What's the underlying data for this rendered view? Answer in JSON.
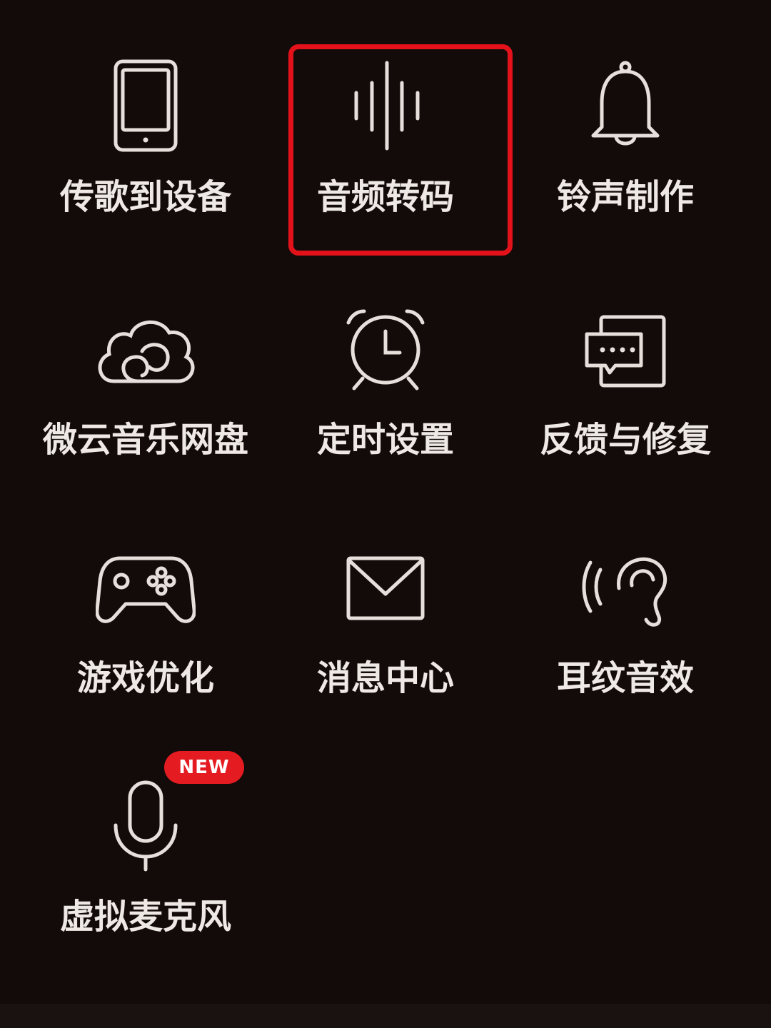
{
  "menu": {
    "items": [
      {
        "label": "传歌到设备",
        "icon": "device-transfer-icon"
      },
      {
        "label": "音频转码",
        "icon": "audio-wave-icon",
        "highlighted": true
      },
      {
        "label": "铃声制作",
        "icon": "bell-icon"
      },
      {
        "label": "微云音乐网盘",
        "icon": "cloud-icon"
      },
      {
        "label": "定时设置",
        "icon": "alarm-clock-icon"
      },
      {
        "label": "反馈与修复",
        "icon": "feedback-message-icon"
      },
      {
        "label": "游戏优化",
        "icon": "gamepad-icon"
      },
      {
        "label": "消息中心",
        "icon": "envelope-icon"
      },
      {
        "label": "耳纹音效",
        "icon": "ear-sound-icon"
      },
      {
        "label": "虚拟麦克风",
        "icon": "microphone-icon",
        "badge": "NEW"
      }
    ]
  },
  "colors": {
    "background": "#130b09",
    "icon_stroke": "#e6dfdc",
    "text": "#efe9e6",
    "highlight_border": "#e3121a",
    "badge": "#e51b22"
  }
}
